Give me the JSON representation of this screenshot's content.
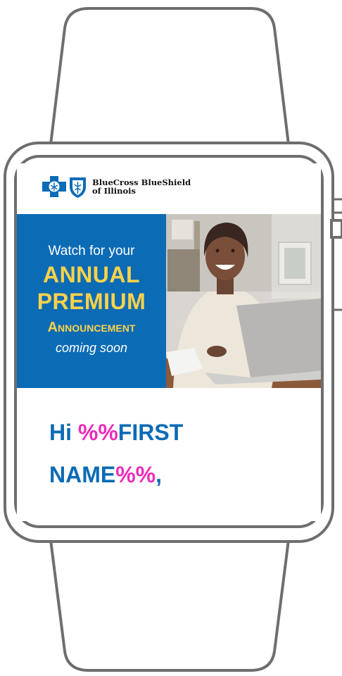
{
  "brand": {
    "name_line1": "BlueCross BlueShield",
    "name_line2": "of Illinois"
  },
  "hero": {
    "line1": "Watch for your",
    "line2": "ANNUAL",
    "line3": "PREMIUM",
    "line4": "Announcement",
    "line5": "coming soon",
    "photo": "woman-smiling-at-laptop"
  },
  "greeting": {
    "hi": "Hi ",
    "merge_open_1": "%%",
    "first": "FIRST",
    "name": "NAME",
    "merge_close": "%%",
    "comma": ","
  },
  "colors": {
    "brand_blue": "#0b6bb5",
    "headline_yellow": "#fcd24a",
    "merge_pink": "#ee2ab8",
    "frame_gray": "#6e6e6e"
  }
}
